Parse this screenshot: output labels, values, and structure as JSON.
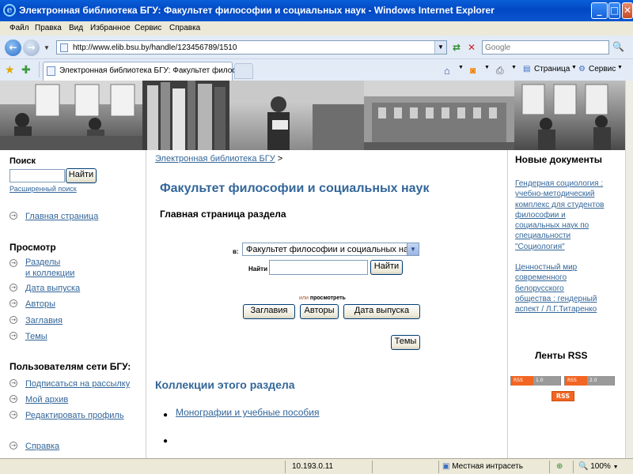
{
  "window": {
    "title": "Электронная библиотека БГУ: Факультет философии и социальных наук - Windows Internet Explorer",
    "logo_icon": "ie-logo-icon"
  },
  "menu": [
    "Файл",
    "Правка",
    "Вид",
    "Избранное",
    "Сервис",
    "Справка"
  ],
  "address": {
    "url": "http://www.elib.bsu.by/handle/123456789/1510",
    "search_placeholder": "Google"
  },
  "tab": {
    "label": "Электронная библиотека БГУ: Факультет философ..."
  },
  "commandbar": {
    "page_label": "Страница",
    "tools_label": "Сервис"
  },
  "left": {
    "search_heading": "Поиск",
    "search_button": "Найти",
    "advanced_search": "Расширенный поиск",
    "home_link": "Главная страница",
    "browse_heading": "Просмотр",
    "browse_links": {
      "sections_line1": "Разделы",
      "sections_line2": "и коллекции",
      "by_date": "Дата выпуска",
      "by_author": "Авторы",
      "by_title": "Заглавия",
      "by_subject": "Темы"
    },
    "users_heading": "Пользователям сети БГУ:",
    "users_links": {
      "subscribe": "Подписаться на рассылку",
      "my_archive": "Мой архив",
      "edit_profile": "Редактировать профиль"
    },
    "help_link": "Справка"
  },
  "main": {
    "breadcrumb_link": "Электронная библиотека БГУ",
    "breadcrumb_sep": ">",
    "community_title": "Факультет философии и социальных наук",
    "section_home": "Главная страница раздела",
    "scope_label": "в:",
    "scope_value": "Факультет философии и социальных наук",
    "find_label": "Найти",
    "find_button": "Найти",
    "or_text": "или",
    "browse_text": "просмотреть",
    "browse_buttons": {
      "titles": "Заглавия",
      "authors": "Авторы",
      "dates": "Дата выпуска",
      "subjects": "Темы"
    },
    "collections_heading": "Коллекции этого раздела",
    "collections": [
      "Монографии и учебные пособия"
    ]
  },
  "right": {
    "new_docs_heading": "Новые документы",
    "doc1_lines": [
      "Гендерная социология :",
      "учебно-методический",
      "комплекс для студентов",
      "философии и",
      "социальных наук по",
      "специальности",
      "\"Социология\""
    ],
    "doc2_lines": [
      "Ценностный мир",
      "современного",
      "белорусского",
      "общества : гендерный",
      "аспект / Л.Г.Титаренко"
    ],
    "rss_heading": "Ленты RSS",
    "rss_badges": {
      "rss1_left": "RSS",
      "rss1_right": "1.0",
      "rss2_left": "RSS",
      "rss2_right": "2.0",
      "rss_plain": "RSS"
    }
  },
  "status": {
    "ip": "10.193.0.11",
    "zone": "Местная интрасеть",
    "zoom": "100%"
  }
}
